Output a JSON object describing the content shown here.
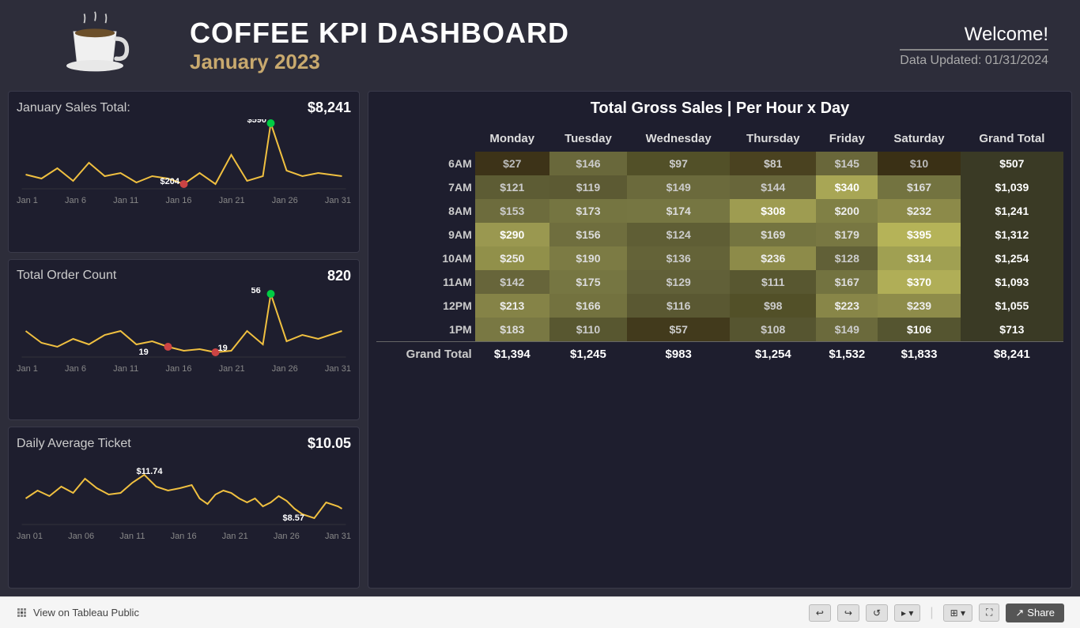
{
  "header": {
    "title": "COFFEE KPI DASHBOARD",
    "subtitle": "January 2023",
    "welcome": "Welcome!",
    "data_updated": "Data Updated: 01/31/2024"
  },
  "kpi_cards": [
    {
      "title": "January Sales Total:",
      "value": "$8,241",
      "chart_max_label": "$590",
      "chart_min_label": "$204",
      "x_labels": [
        "Jan 1",
        "Jan 6",
        "Jan 11",
        "Jan 16",
        "Jan 21",
        "Jan 26",
        "Jan 31"
      ]
    },
    {
      "title": "Total Order Count",
      "value": "820",
      "chart_max_label": "56",
      "chart_min_label": "19",
      "x_labels": [
        "Jan 1",
        "Jan 6",
        "Jan 11",
        "Jan 16",
        "Jan 21",
        "Jan 26",
        "Jan 31"
      ]
    },
    {
      "title": "Daily Average Ticket",
      "value": "$10.05",
      "chart_max_label": "$11.74",
      "chart_min_label": "$8.57",
      "x_labels": [
        "Jan 01",
        "Jan 06",
        "Jan 11",
        "Jan 16",
        "Jan 21",
        "Jan 26",
        "Jan 31"
      ]
    }
  ],
  "table": {
    "title": "Total Gross Sales | Per Hour x Day",
    "columns": [
      "Monday",
      "Tuesday",
      "Wednesday",
      "Thursday",
      "Friday",
      "Saturday",
      "Grand Total"
    ],
    "rows": [
      {
        "label": "6AM",
        "values": [
          "$27",
          "$146",
          "$97",
          "$81",
          "$145",
          "$10",
          "$507"
        ]
      },
      {
        "label": "7AM",
        "values": [
          "$121",
          "$119",
          "$149",
          "$144",
          "$340",
          "$167",
          "$1,039"
        ]
      },
      {
        "label": "8AM",
        "values": [
          "$153",
          "$173",
          "$174",
          "$308",
          "$200",
          "$232",
          "$1,241"
        ]
      },
      {
        "label": "9AM",
        "values": [
          "$290",
          "$156",
          "$124",
          "$169",
          "$179",
          "$395",
          "$1,312"
        ]
      },
      {
        "label": "10AM",
        "values": [
          "$250",
          "$190",
          "$136",
          "$236",
          "$128",
          "$314",
          "$1,254"
        ]
      },
      {
        "label": "11AM",
        "values": [
          "$142",
          "$175",
          "$129",
          "$111",
          "$167",
          "$370",
          "$1,093"
        ]
      },
      {
        "label": "12PM",
        "values": [
          "$213",
          "$166",
          "$116",
          "$98",
          "$223",
          "$239",
          "$1,055"
        ]
      },
      {
        "label": "1PM",
        "values": [
          "$183",
          "$110",
          "$57",
          "$108",
          "$149",
          "$106",
          "$713"
        ]
      }
    ],
    "grand_total": {
      "label": "Grand Total",
      "values": [
        "$1,394",
        "$1,245",
        "$983",
        "$1,254",
        "$1,532",
        "$1,833",
        "$8,241"
      ]
    }
  },
  "bottom_bar": {
    "tableau_link": "View on Tableau Public",
    "share_label": "Share"
  }
}
